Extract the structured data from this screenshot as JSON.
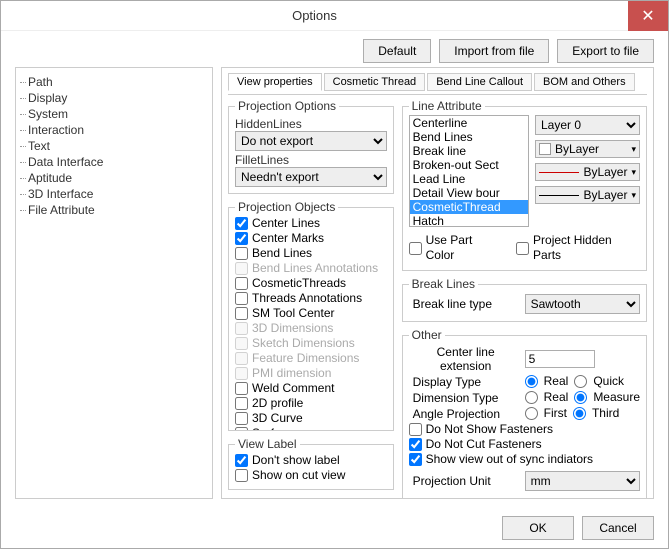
{
  "title": "Options",
  "close": "✕",
  "topButtons": {
    "default": "Default",
    "import": "Import from file",
    "export": "Export to file"
  },
  "tree": [
    "Path",
    "Display",
    "System",
    "Interaction",
    "Text",
    "Data Interface",
    "Aptitude",
    "3D Interface",
    "File Attribute"
  ],
  "tabs": [
    "View properties",
    "Cosmetic Thread",
    "Bend Line Callout",
    "BOM and Others"
  ],
  "proj": {
    "legend": "Projection Options",
    "hiddenLabel": "HiddenLines",
    "hiddenValue": "Do not export",
    "filletLabel": "FilletLines",
    "filletValue": "Needn't export"
  },
  "objs": {
    "legend": "Projection Objects",
    "items": [
      {
        "label": "Center Lines",
        "checked": true,
        "disabled": false
      },
      {
        "label": "Center Marks",
        "checked": true,
        "disabled": false
      },
      {
        "label": "Bend Lines",
        "checked": false,
        "disabled": false
      },
      {
        "label": "Bend Lines Annotations",
        "checked": false,
        "disabled": true
      },
      {
        "label": "CosmeticThreads",
        "checked": false,
        "disabled": false
      },
      {
        "label": "Threads Annotations",
        "checked": false,
        "disabled": false
      },
      {
        "label": "SM Tool Center",
        "checked": false,
        "disabled": false
      },
      {
        "label": "3D Dimensions",
        "checked": false,
        "disabled": true
      },
      {
        "label": "Sketch Dimensions",
        "checked": false,
        "disabled": true
      },
      {
        "label": "Feature Dimensions",
        "checked": false,
        "disabled": true
      },
      {
        "label": "PMI dimension",
        "checked": false,
        "disabled": true
      },
      {
        "label": "Weld Comment",
        "checked": false,
        "disabled": false
      },
      {
        "label": "2D profile",
        "checked": false,
        "disabled": false
      },
      {
        "label": "3D Curve",
        "checked": false,
        "disabled": false
      },
      {
        "label": "Surface",
        "checked": false,
        "disabled": false
      }
    ]
  },
  "viewLabel": {
    "legend": "View Label",
    "dontShow": "Don't show label",
    "dontShowChecked": true,
    "showCut": "Show on cut view",
    "showCutChecked": false
  },
  "lineAttr": {
    "legend": "Line Attribute",
    "list": [
      "Centerline",
      "Bend Lines",
      "Break line",
      "Broken-out Sect",
      "Lead Line",
      "Detail View bour",
      "CosmeticThread",
      "Hatch"
    ],
    "selectedIndex": 6,
    "layer": "Layer 0",
    "color": "ByLayer",
    "linetype": "ByLayer",
    "lineweight": "ByLayer",
    "usePart": "Use Part Color",
    "projHidden": "Project Hidden Parts"
  },
  "breakLines": {
    "legend": "Break Lines",
    "typeLabel": "Break line type",
    "typeValue": "Sawtooth"
  },
  "other": {
    "legend": "Other",
    "clext": "Center line\nextension",
    "clextVal": "5",
    "dispType": "Display Type",
    "real": "Real",
    "quick": "Quick",
    "dimType": "Dimension Type",
    "measure": "Measure",
    "angProj": "Angle Projection",
    "first": "First",
    "third": "Third",
    "noShowFast": "Do Not Show Fasteners",
    "noCutFast": "Do Not Cut Fasteners",
    "showSync": "Show view out of sync indiators",
    "projUnit": "Projection Unit",
    "projUnitVal": "mm"
  },
  "footer": {
    "ok": "OK",
    "cancel": "Cancel"
  }
}
